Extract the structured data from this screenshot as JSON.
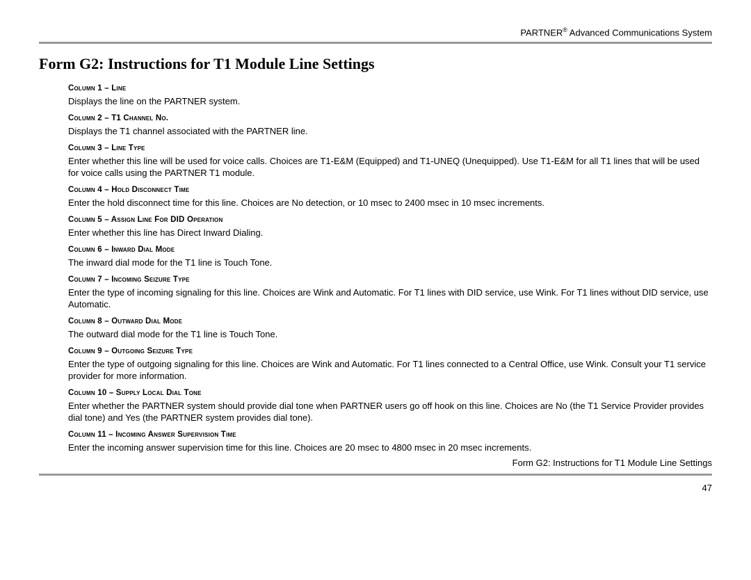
{
  "header": {
    "brand": "PARTNER",
    "reg": "®",
    "product": "Advanced Communications System"
  },
  "title": "Form G2: Instructions for T1 Module Line Settings",
  "columns": [
    {
      "head": "Column 1 – Line",
      "body": "Displays the line on the PARTNER system."
    },
    {
      "head": "Column 2 – T1 Channel No.",
      "body": "Displays the T1 channel associated with the PARTNER line."
    },
    {
      "head": "Column 3 – Line Type",
      "body": "Enter whether this line will be used for voice calls. Choices are T1-E&M (Equipped) and T1-UNEQ (Unequipped). Use T1-E&M for all T1 lines that will be used for voice calls using the PARTNER T1 module."
    },
    {
      "head": "Column 4 – Hold Disconnect Time",
      "body": "Enter the hold disconnect time for this line. Choices are No detection, or 10 msec to 2400 msec in 10 msec increments."
    },
    {
      "head": "Column 5 – Assign Line For DID Operation",
      "body": "Enter whether this line has Direct Inward Dialing."
    },
    {
      "head": "Column 6 – Inward Dial Mode",
      "body": "The inward dial mode for the T1 line is Touch Tone."
    },
    {
      "head": "Column 7 – Incoming Seizure Type",
      "body": "Enter the type of incoming signaling for this line. Choices are Wink and Automatic. For T1 lines with DID service, use Wink. For T1 lines without DID service, use Automatic."
    },
    {
      "head": "Column 8 – Outward Dial Mode",
      "body": "The outward dial mode for the T1 line is Touch Tone."
    },
    {
      "head": "Column 9 – Outgoing Seizure Type",
      "body": "Enter the type of outgoing signaling for this line. Choices are Wink and Automatic. For T1 lines connected to a Central Office, use Wink. Consult your T1 service provider for more information."
    },
    {
      "head": "Column 10 – Supply Local Dial Tone",
      "body": "Enter whether the PARTNER system should provide dial tone when PARTNER users go off hook on this line. Choices are No (the T1 Service Provider provides dial tone) and Yes (the PARTNER system provides dial tone)."
    },
    {
      "head": "Column 11 – Incoming Answer Supervision Time",
      "body": "Enter the incoming answer supervision time for this line. Choices are 20 msec to 4800 msec in 20 msec increments."
    }
  ],
  "footer": {
    "text": "Form G2: Instructions for T1 Module Line Settings",
    "page": "47"
  }
}
